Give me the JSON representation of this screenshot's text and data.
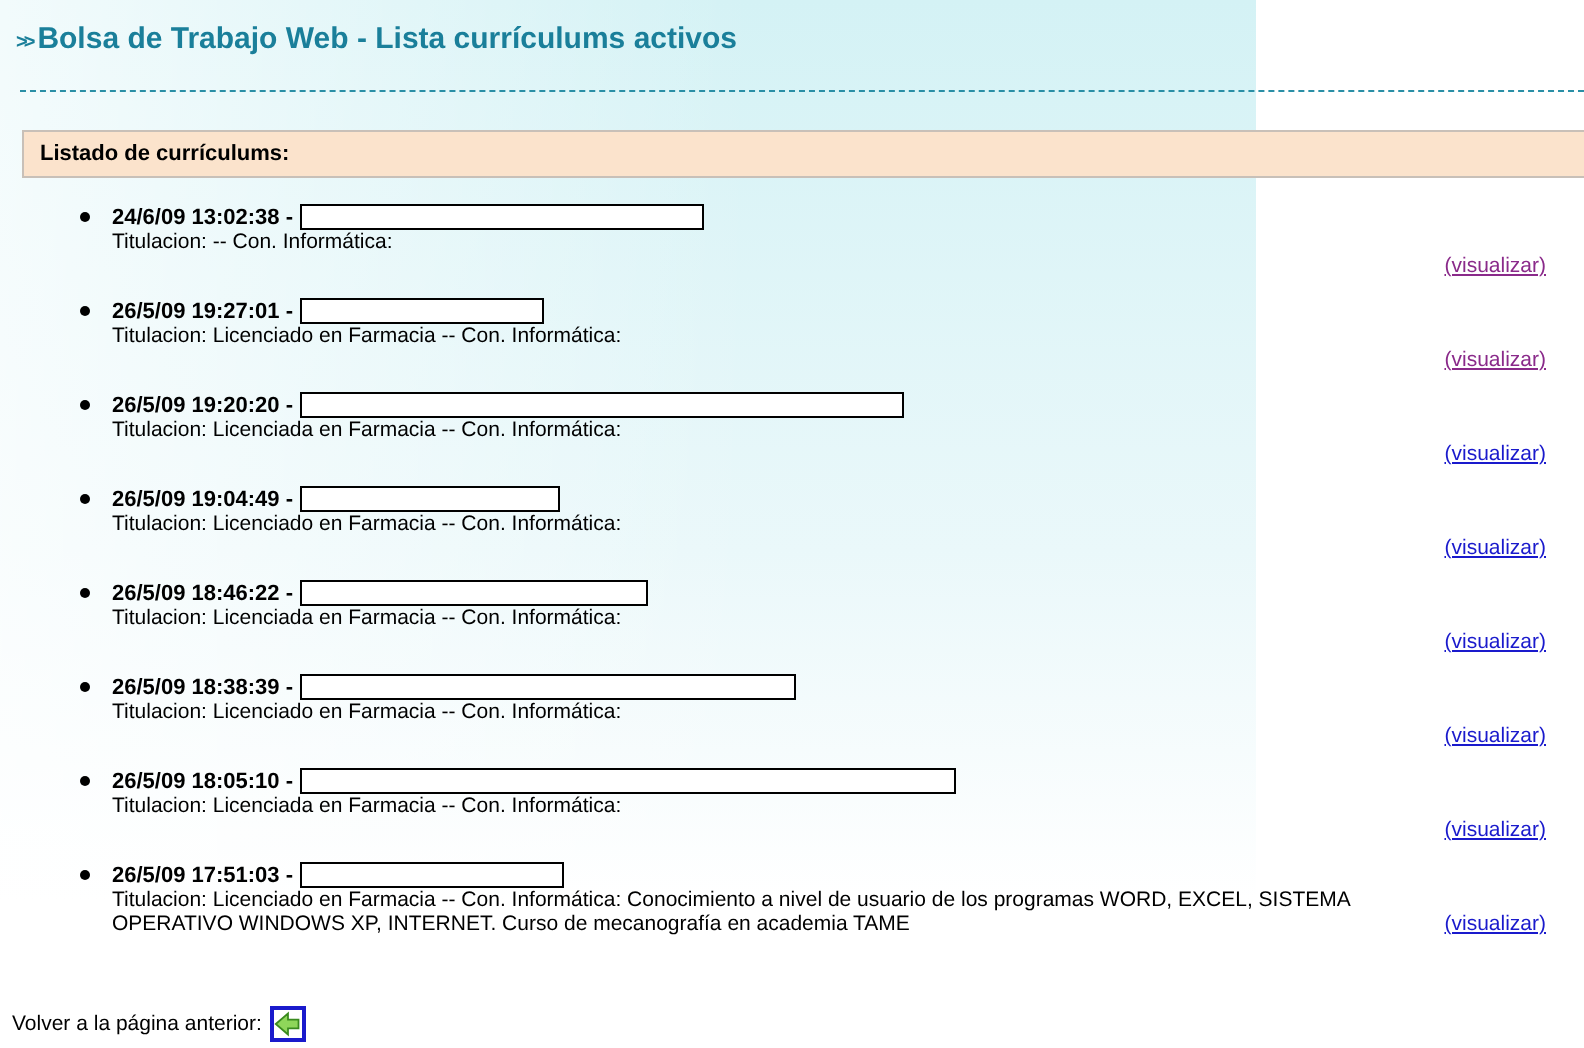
{
  "page_title": {
    "marker": ">>",
    "text": "Bolsa de Trabajo Web - Lista currículums activos"
  },
  "list": {
    "heading": "Listado de currículums:",
    "items": [
      {
        "timestamp": "24/6/09 13:02:38 -",
        "details": "Titulacion: -- Con. Informática:",
        "link": "(visualizar)",
        "visited": true
      },
      {
        "timestamp": "26/5/09 19:27:01 -",
        "details": "Titulacion: Licenciado en Farmacia -- Con. Informática:",
        "link": "(visualizar)",
        "visited": true
      },
      {
        "timestamp": "26/5/09 19:20:20 -",
        "details": "Titulacion: Licenciada en Farmacia -- Con. Informática:",
        "link": "(visualizar)",
        "visited": false
      },
      {
        "timestamp": "26/5/09 19:04:49 -",
        "details": "Titulacion: Licenciado en Farmacia -- Con. Informática:",
        "link": "(visualizar)",
        "visited": false
      },
      {
        "timestamp": "26/5/09 18:46:22 -",
        "details": "Titulacion: Licenciada en Farmacia -- Con. Informática:",
        "link": "(visualizar)",
        "visited": false
      },
      {
        "timestamp": "26/5/09 18:38:39 -",
        "details": "Titulacion: Licenciado en Farmacia -- Con. Informática:",
        "link": "(visualizar)",
        "visited": false
      },
      {
        "timestamp": "26/5/09 18:05:10 -",
        "details": "Titulacion: Licenciada en Farmacia -- Con. Informática:",
        "link": "(visualizar)",
        "visited": false
      },
      {
        "timestamp": "26/5/09 17:51:03 -",
        "details": "Titulacion: Licenciado en Farmacia -- Con. Informática: Conocimiento a nivel de usuario de los programas WORD, EXCEL, SISTEMA OPERATIVO WINDOWS XP, INTERNET. Curso de mecanografía en academia TAME",
        "link": "(visualizar)",
        "visited": false
      }
    ]
  },
  "footer": {
    "label": "Volver a la página anterior:"
  }
}
